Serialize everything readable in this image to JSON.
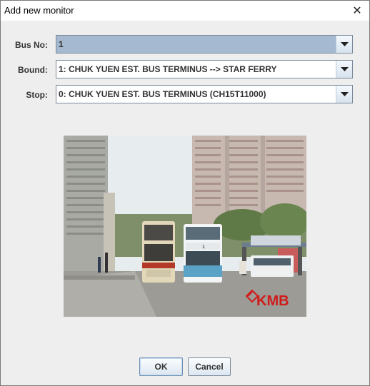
{
  "window": {
    "title": "Add new monitor",
    "close_glyph": "✕"
  },
  "form": {
    "bus_no": {
      "label": "Bus No:",
      "value": "1"
    },
    "bound": {
      "label": "Bound:",
      "value": "1: CHUK YUEN EST. BUS TERMINUS --> STAR FERRY"
    },
    "stop": {
      "label": "Stop:",
      "value": "0: CHUK YUEN EST. BUS TERMINUS (CH15T11000)"
    }
  },
  "image": {
    "bus_front_sign": "1",
    "logo_text": "KMB"
  },
  "buttons": {
    "ok": "OK",
    "cancel": "Cancel"
  },
  "icons": {
    "close": "close-icon",
    "dropdown": "chevron-down-icon"
  },
  "colors": {
    "selected_field": "#a5b9d0",
    "logo_red": "#d11a1a"
  }
}
